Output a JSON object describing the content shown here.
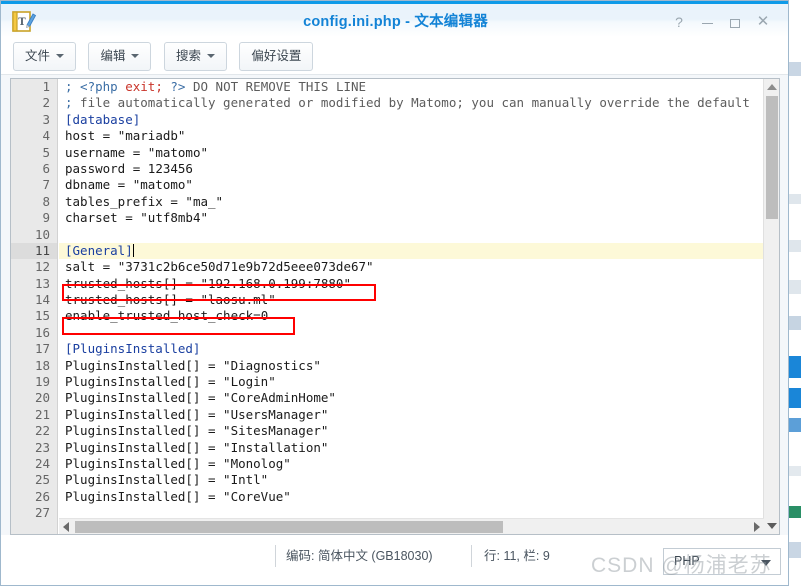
{
  "window": {
    "title": "config.ini.php - 文本编辑器",
    "app_icon": "text-editor-icon",
    "controls": {
      "help": "?",
      "minimize": "minimize-icon",
      "maximize": "maximize-icon",
      "close": "✕"
    }
  },
  "toolbar": {
    "buttons": [
      {
        "label": "文件",
        "has_caret": true
      },
      {
        "label": "编辑",
        "has_caret": true
      },
      {
        "label": "搜索",
        "has_caret": true
      },
      {
        "label": "偏好设置",
        "has_caret": false
      }
    ]
  },
  "editor": {
    "cursor_line": 11,
    "first_line": 1,
    "last_line": 27,
    "lines": [
      {
        "n": 1,
        "text": "; <?php exit; ?> DO NOT REMOVE THIS LINE"
      },
      {
        "n": 2,
        "text": "; file automatically generated or modified by Matomo; you can manually override the default"
      },
      {
        "n": 3,
        "text": "[database]"
      },
      {
        "n": 4,
        "text": "host = \"mariadb\""
      },
      {
        "n": 5,
        "text": "username = \"matomo\""
      },
      {
        "n": 6,
        "text": "password = 123456"
      },
      {
        "n": 7,
        "text": "dbname = \"matomo\""
      },
      {
        "n": 8,
        "text": "tables_prefix = \"ma_\""
      },
      {
        "n": 9,
        "text": "charset = \"utf8mb4\""
      },
      {
        "n": 10,
        "text": ""
      },
      {
        "n": 11,
        "text": "[General]"
      },
      {
        "n": 12,
        "text": "salt = \"3731c2b6ce50d71e9b72d5eee073de67\""
      },
      {
        "n": 13,
        "text": "trusted_hosts[] = \"192.168.0.199:7880\""
      },
      {
        "n": 14,
        "text": "trusted_hosts[] = \"laosu.ml\""
      },
      {
        "n": 15,
        "text": "enable_trusted_host_check=0"
      },
      {
        "n": 16,
        "text": ""
      },
      {
        "n": 17,
        "text": "[PluginsInstalled]"
      },
      {
        "n": 18,
        "text": "PluginsInstalled[] = \"Diagnostics\""
      },
      {
        "n": 19,
        "text": "PluginsInstalled[] = \"Login\""
      },
      {
        "n": 20,
        "text": "PluginsInstalled[] = \"CoreAdminHome\""
      },
      {
        "n": 21,
        "text": "PluginsInstalled[] = \"UsersManager\""
      },
      {
        "n": 22,
        "text": "PluginsInstalled[] = \"SitesManager\""
      },
      {
        "n": 23,
        "text": "PluginsInstalled[] = \"Installation\""
      },
      {
        "n": 24,
        "text": "PluginsInstalled[] = \"Monolog\""
      },
      {
        "n": 25,
        "text": "PluginsInstalled[] = \"Intl\""
      },
      {
        "n": 26,
        "text": "PluginsInstalled[] = \"CoreVue\""
      },
      {
        "n": 27,
        "text": ""
      }
    ],
    "annotations": [
      {
        "target_line": 13,
        "color": "#ff0000"
      },
      {
        "target_line": 15,
        "color": "#ff0000"
      }
    ]
  },
  "statusbar": {
    "encoding": "编码: 简体中文 (GB18030)",
    "position": "行: 11, 栏: 9",
    "language": "PHP"
  },
  "watermark": "CSDN @杨浦老苏",
  "colors": {
    "accent": "#0e9ae8",
    "title_text": "#1383d6",
    "annotation": "#ff0000",
    "current_line": "#fdf9d8",
    "gutter": "#e9e9e9"
  }
}
